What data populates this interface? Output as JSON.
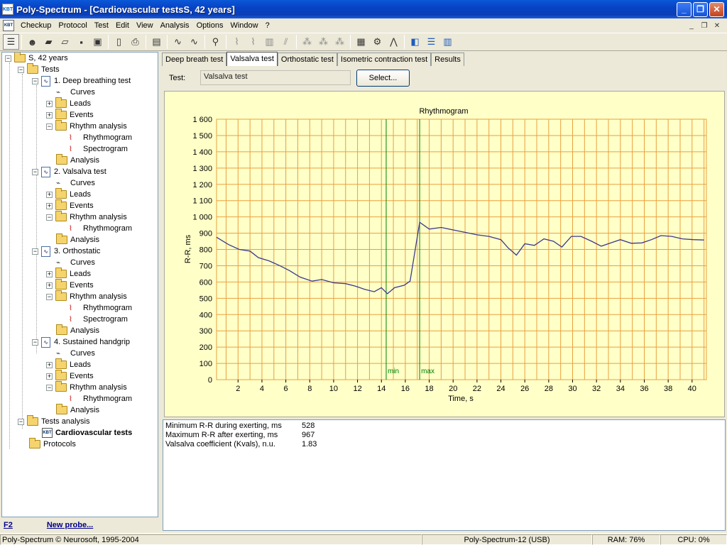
{
  "window": {
    "title": "Poly-Spectrum - [Cardiovascular testsS, 42 years]",
    "app_icon": "KBT",
    "minimize": "_",
    "maximize": "❐",
    "close": "✕"
  },
  "menu": {
    "items": [
      "Checkup",
      "Protocol",
      "Test",
      "Edit",
      "View",
      "Analysis",
      "Options",
      "Window",
      "?"
    ],
    "mdi_minimize": "_",
    "mdi_restore": "❐",
    "mdi_close": "✕"
  },
  "tree": {
    "root": "S, 42 years",
    "tests": "Tests",
    "t1": "1. Deep breathing test",
    "t2": "2. Valsalva test",
    "t3": "3. Orthostatic",
    "t4": "4. Sustained handgrip",
    "curves": "Curves",
    "leads": "Leads",
    "events": "Events",
    "rhythm_analysis": "Rhythm analysis",
    "rhythmogram": "Rhythmogram",
    "spectrogram": "Spectrogram",
    "analysis": "Analysis",
    "tests_analysis": "Tests analysis",
    "cardio": "Cardiovascular tests",
    "protocols": "Protocols"
  },
  "bottom_left": {
    "f2": "F2",
    "new_probe": "New probe..."
  },
  "tabs": [
    "Deep breath test",
    "Valsalva test",
    "Orthostatic test",
    "Isometric contraction test",
    "Results"
  ],
  "test_selector": {
    "label": "Test:",
    "value": "Valsalva test",
    "button": "Select..."
  },
  "chart_data": {
    "type": "line",
    "title": "Rhythmogram",
    "xlabel": "Time, s",
    "ylabel": "R-R, ms",
    "xlim": [
      0.2,
      41.2
    ],
    "ylim": [
      0,
      1600
    ],
    "xticks": [
      2,
      4,
      6,
      8,
      10,
      12,
      14,
      16,
      18,
      20,
      22,
      24,
      26,
      28,
      30,
      32,
      34,
      36,
      38,
      40
    ],
    "yticks": [
      0,
      100,
      200,
      300,
      400,
      500,
      600,
      700,
      800,
      900,
      1000,
      1100,
      1200,
      1300,
      1400,
      1500,
      1600
    ],
    "ytick_labels": [
      "0",
      "100",
      "200",
      "300",
      "400",
      "500",
      "600",
      "700",
      "800",
      "900",
      "1 000",
      "1 100",
      "1 200",
      "1 300",
      "1 400",
      "1 500",
      "1 600"
    ],
    "markers": [
      {
        "label": "min",
        "x": 14.4
      },
      {
        "label": "max",
        "x": 17.2
      }
    ],
    "line_color": "#3a3a8c",
    "grid_color": "#e8a040",
    "marker_color": "#008000",
    "series": [
      {
        "x": [
          0.2,
          1.2,
          2.1,
          3.0,
          3.7,
          4.6,
          5.5,
          6.3,
          7.2,
          8.2,
          9.0,
          10.0,
          11.0,
          11.8,
          12.6,
          13.4,
          14.0,
          14.5,
          15.1,
          15.9,
          16.4,
          17.2,
          18.0,
          19.0,
          20.0,
          21.0,
          22.0,
          23.0,
          24.0,
          24.6,
          25.3,
          26.0,
          26.8,
          27.6,
          28.4,
          29.1,
          29.9,
          30.7,
          31.6,
          32.4,
          33.2,
          34.0,
          34.9,
          35.8,
          36.6,
          37.4,
          38.3,
          39.2,
          40.1,
          41.0
        ],
        "y": [
          875,
          830,
          800,
          790,
          750,
          730,
          700,
          670,
          630,
          605,
          615,
          595,
          590,
          575,
          555,
          540,
          565,
          528,
          565,
          580,
          605,
          967,
          925,
          935,
          920,
          905,
          890,
          880,
          860,
          810,
          765,
          835,
          825,
          865,
          850,
          815,
          880,
          880,
          850,
          820,
          840,
          860,
          838,
          840,
          860,
          885,
          880,
          865,
          860,
          858
        ]
      }
    ]
  },
  "results": [
    {
      "label": "Minimum R-R during exerting, ms",
      "value": "528"
    },
    {
      "label": "Maximum R-R after exerting, ms",
      "value": "967"
    },
    {
      "label": "Valsalva coefficient (Kvals), n.u.",
      "value": "1.83"
    }
  ],
  "status": {
    "copyright": "Poly-Spectrum © Neurosoft, 1995-2004",
    "device": "Poly-Spectrum-12 (USB)",
    "ram": "RAM: 76%",
    "cpu": "CPU: 0%"
  },
  "icons": {
    "toolbar": [
      "tree-view-icon",
      "user-icon",
      "new-folder-icon",
      "open-folder-icon",
      "save-icon",
      "lock-icon",
      "print-preview-icon",
      "print-icon",
      "protocol-icon",
      "ecg-icon",
      "ecg-doc-icon",
      "zoom-icon",
      "chart-line-icon",
      "chart-area-icon",
      "chart-bar-icon",
      "chart-diag-icon",
      "scatter1-icon",
      "scatter2-icon",
      "scatter3-icon",
      "kbt-icon",
      "bike-icon",
      "graph-icon",
      "cascade-icon",
      "tile-horizontal-icon",
      "tile-vertical-icon"
    ]
  }
}
